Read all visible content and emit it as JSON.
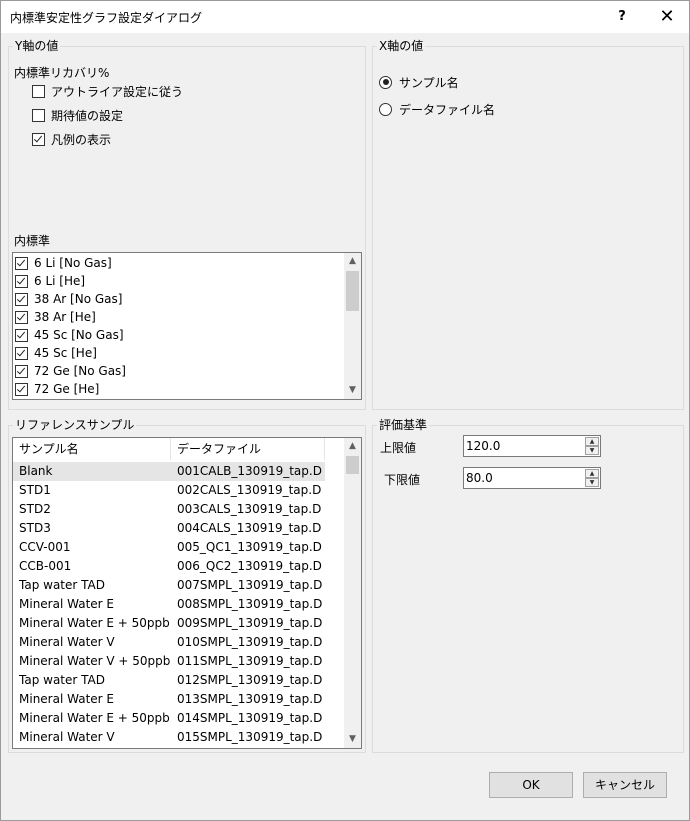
{
  "window": {
    "title": "内標準安定性グラフ設定ダイアログ",
    "help_label": "?",
    "close_label": "✕"
  },
  "y_axis": {
    "group_label": "Y軸の値",
    "recovery_label": "内標準リカバリ%",
    "options": [
      {
        "label": "アウトライア設定に従う",
        "checked": false
      },
      {
        "label": "期待値の設定",
        "checked": false
      },
      {
        "label": "凡例の表示",
        "checked": true
      }
    ],
    "internal_std_label": "内標準",
    "internal_standards": [
      {
        "label": "6 Li [No Gas]",
        "checked": true
      },
      {
        "label": "6 Li [He]",
        "checked": true
      },
      {
        "label": "38 Ar [No Gas]",
        "checked": true
      },
      {
        "label": "38 Ar [He]",
        "checked": true
      },
      {
        "label": "45 Sc [No Gas]",
        "checked": true
      },
      {
        "label": "45 Sc [He]",
        "checked": true
      },
      {
        "label": "72 Ge [No Gas]",
        "checked": true
      },
      {
        "label": "72 Ge [He]",
        "checked": true
      }
    ]
  },
  "x_axis": {
    "group_label": "X軸の値",
    "options": [
      {
        "label": "サンプル名",
        "checked": true
      },
      {
        "label": "データファイル名",
        "checked": false
      }
    ]
  },
  "reference": {
    "group_label": "リファレンスサンプル",
    "columns": [
      "サンプル名",
      "データファイル"
    ],
    "rows": [
      {
        "name": "Blank",
        "file": "001CALB_130919_tap.D"
      },
      {
        "name": "STD1",
        "file": "002CALS_130919_tap.D"
      },
      {
        "name": "STD2",
        "file": "003CALS_130919_tap.D"
      },
      {
        "name": "STD3",
        "file": "004CALS_130919_tap.D"
      },
      {
        "name": "CCV-001",
        "file": "005_QC1_130919_tap.D"
      },
      {
        "name": "CCB-001",
        "file": "006_QC2_130919_tap.D"
      },
      {
        "name": "Tap water TAD",
        "file": "007SMPL_130919_tap.D"
      },
      {
        "name": "Mineral Water E",
        "file": "008SMPL_130919_tap.D"
      },
      {
        "name": "Mineral Water E + 50ppb",
        "file": "009SMPL_130919_tap.D"
      },
      {
        "name": "Mineral Water V",
        "file": "010SMPL_130919_tap.D"
      },
      {
        "name": "Mineral Water V + 50ppb",
        "file": "011SMPL_130919_tap.D"
      },
      {
        "name": "Tap water TAD",
        "file": "012SMPL_130919_tap.D"
      },
      {
        "name": "Mineral Water E",
        "file": "013SMPL_130919_tap.D"
      },
      {
        "name": "Mineral Water E + 50ppb",
        "file": "014SMPL_130919_tap.D"
      },
      {
        "name": "Mineral Water V",
        "file": "015SMPL_130919_tap.D"
      }
    ]
  },
  "criteria": {
    "group_label": "評価基準",
    "upper_label": "上限値",
    "upper_value": "120.0",
    "lower_label": "下限値",
    "lower_value": "80.0"
  },
  "buttons": {
    "ok": "OK",
    "cancel": "キャンセル"
  }
}
